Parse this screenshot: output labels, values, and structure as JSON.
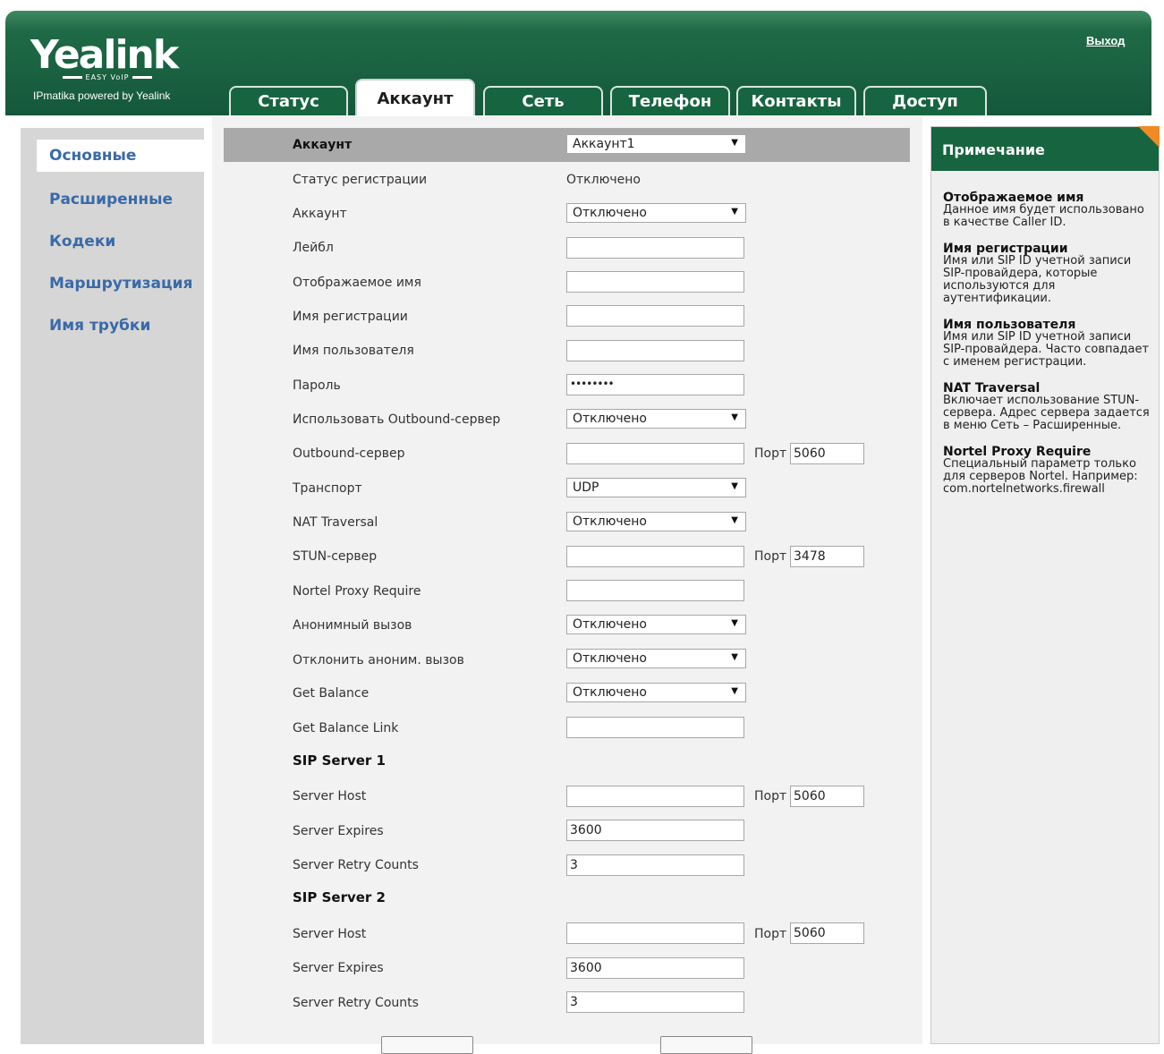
{
  "header": {
    "logo_text": "Yealink",
    "logo_sub": "EASY VoIP",
    "tagline": "IPmatika powered by Yealink",
    "logout_label": "Выход",
    "tabs": [
      {
        "label": "Статус"
      },
      {
        "label": "Аккаунт"
      },
      {
        "label": "Сеть"
      },
      {
        "label": "Телефон"
      },
      {
        "label": "Контакты"
      },
      {
        "label": "Доступ"
      }
    ]
  },
  "sidebar": {
    "items": [
      {
        "label": "Основные"
      },
      {
        "label": "Расширенные"
      },
      {
        "label": "Кодеки"
      },
      {
        "label": "Маршрутизация"
      },
      {
        "label": "Имя трубки"
      }
    ]
  },
  "form": {
    "account_label": "Аккаунт",
    "account_value": "Аккаунт1",
    "reg_status_label": "Статус регистрации",
    "reg_status_value": "Отключено",
    "account_enable_label": "Аккаунт",
    "account_enable_value": "Отключено",
    "label_label": "Лейбл",
    "label_value": "",
    "display_name_label": "Отображаемое имя",
    "display_name_value": "",
    "register_name_label": "Имя регистрации",
    "register_name_value": "",
    "username_label": "Имя пользователя",
    "username_value": "",
    "password_label": "Пароль",
    "password_value": "••••••••",
    "use_outbound_label": "Использовать Outbound-сервер",
    "use_outbound_value": "Отключено",
    "outbound_label": "Outbound-сервер",
    "outbound_value": "",
    "outbound_port": "5060",
    "transport_label": "Транспорт",
    "transport_value": "UDP",
    "nat_label": "NAT Traversal",
    "nat_value": "Отключено",
    "stun_label": "STUN-сервер",
    "stun_value": "",
    "stun_port": "3478",
    "nortel_label": "Nortel Proxy Require",
    "nortel_value": "",
    "anon_call_label": "Анонимный вызов",
    "anon_call_value": "Отключено",
    "reject_anon_label": "Отклонить аноним. вызов",
    "reject_anon_value": "Отключено",
    "get_balance_label": "Get Balance",
    "get_balance_value": "Отключено",
    "get_balance_link_label": "Get Balance Link",
    "get_balance_link_value": "",
    "port_label": "Порт",
    "sip1": {
      "title": "SIP Server 1",
      "host_label": "Server Host",
      "host_value": "",
      "port": "5060",
      "expires_label": "Server Expires",
      "expires_value": "3600",
      "retry_label": "Server Retry Counts",
      "retry_value": "3"
    },
    "sip2": {
      "title": "SIP Server 2",
      "host_label": "Server Host",
      "host_value": "",
      "port": "5060",
      "expires_label": "Server Expires",
      "expires_value": "3600",
      "retry_label": "Server Retry Counts",
      "retry_value": "3"
    }
  },
  "note": {
    "title": "Примечание",
    "items": [
      {
        "title": "Отображаемое имя",
        "text": "Данное имя будет использовано в качестве Caller ID."
      },
      {
        "title": "Имя регистрации",
        "text": "Имя или SIP ID учетной записи SIP-провайдера, которые используются для аутентификации."
      },
      {
        "title": "Имя пользователя",
        "text": "Имя или SIP ID учетной записи SIP-провайдера. Часто совпадает с именем регистрации."
      },
      {
        "title": "NAT Traversal",
        "text": "Включает использование STUN-сервера. Адрес сервера задается в меню Сеть – Расширенные."
      },
      {
        "title": "Nortel Proxy Require",
        "text": "Специальный параметр только для серверов Nortel. Например: com.nortelnetworks.firewall"
      }
    ]
  },
  "colors": {
    "header_green": "#176540",
    "link_blue": "#3a6aa8",
    "note_corner": "#f08a24"
  }
}
